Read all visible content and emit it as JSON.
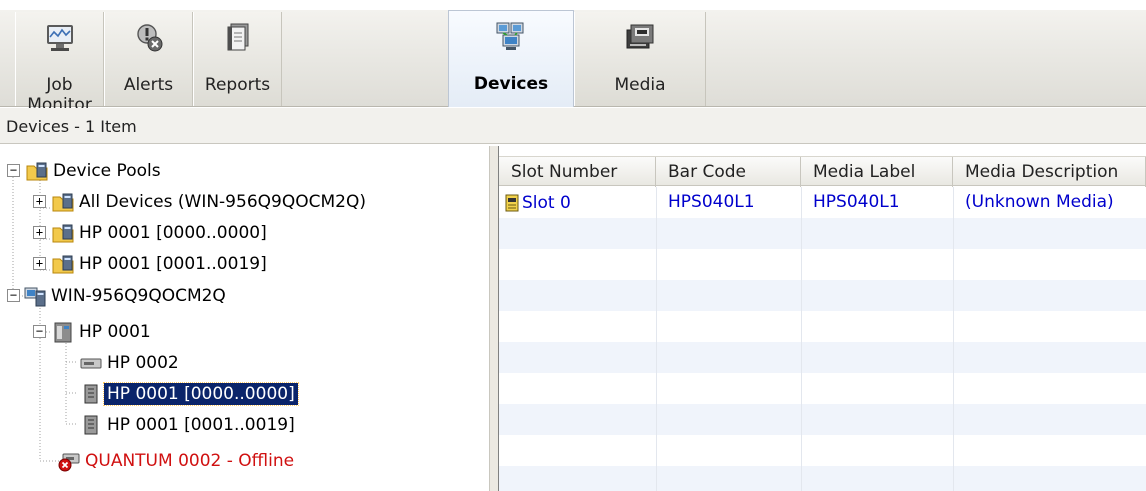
{
  "toolbar": {
    "tabs": [
      {
        "label": "Job Monitor",
        "icon": "job-monitor-icon"
      },
      {
        "label": "Alerts",
        "icon": "alerts-icon"
      },
      {
        "label": "Reports",
        "icon": "reports-icon"
      },
      {
        "label": "Devices",
        "icon": "devices-icon",
        "active": true
      },
      {
        "label": "Media",
        "icon": "media-icon"
      }
    ]
  },
  "status": {
    "text": "Devices - 1 Item"
  },
  "tree": {
    "nodes": [
      {
        "label": "Device Pools",
        "icon": "device-pool-icon",
        "expander": "−"
      },
      {
        "label": "All Devices (WIN-956Q9QOCM2Q)",
        "icon": "device-pool-icon",
        "expander": "+"
      },
      {
        "label": "HP 0001 [0000..0000]",
        "icon": "device-pool-icon",
        "expander": "+"
      },
      {
        "label": "HP 0001 [0001..0019]",
        "icon": "device-pool-icon",
        "expander": "+"
      },
      {
        "label": "WIN-956Q9QOCM2Q",
        "icon": "server-icon",
        "expander": "−"
      },
      {
        "label": "HP 0001",
        "icon": "library-icon",
        "expander": "−"
      },
      {
        "label": "HP 0002",
        "icon": "tape-drive-icon"
      },
      {
        "label": "HP 0001 [0000..0000]",
        "icon": "slot-group-icon",
        "selected": true
      },
      {
        "label": "HP 0001 [0001..0019]",
        "icon": "slot-group-icon"
      },
      {
        "label": "QUANTUM 0002 - Offline",
        "icon": "offline-drive-icon",
        "offline": true
      }
    ]
  },
  "grid": {
    "columns": [
      "Slot Number",
      "Bar Code",
      "Media Label",
      "Media Description"
    ],
    "rows": [
      {
        "slot": "Slot 0",
        "bar_code": "HPS040L1",
        "media_label": "HPS040L1",
        "media_description": "(Unknown Media)"
      }
    ]
  },
  "colors": {
    "selection": "#0a246a",
    "link_text": "#0000cc",
    "offline_text": "#d01010"
  }
}
